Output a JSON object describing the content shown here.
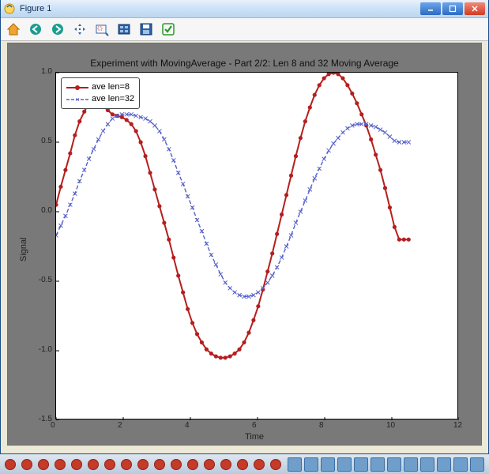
{
  "window": {
    "title": "Figure 1",
    "buttons": {
      "minimize": "_",
      "maximize": "❐",
      "close": "✕"
    }
  },
  "toolbar": {
    "icons": [
      "home",
      "back",
      "forward",
      "pan",
      "zoom",
      "configure",
      "save",
      "check"
    ]
  },
  "chart_data": {
    "type": "line",
    "title": "Experiment with MovingAverage - Part 2/2: Len 8 and 32 Moving Average",
    "xlabel": "Time",
    "ylabel": "Signal",
    "xlim": [
      0,
      12
    ],
    "ylim": [
      -1.5,
      1.0
    ],
    "xticks": [
      0,
      2,
      4,
      6,
      8,
      10,
      12
    ],
    "yticks": [
      -1.5,
      -1.0,
      -0.5,
      0.0,
      0.5,
      1.0
    ],
    "legend": {
      "position": "upper left",
      "entries": [
        "ave len=8",
        "ave len=32"
      ]
    },
    "series": [
      {
        "name": "ave len=8",
        "color": "#b51f1f",
        "marker": "o",
        "linestyle": "solid",
        "x": [
          0.0,
          0.14,
          0.28,
          0.42,
          0.56,
          0.7,
          0.84,
          0.98,
          1.12,
          1.26,
          1.4,
          1.54,
          1.68,
          1.82,
          1.96,
          2.1,
          2.24,
          2.38,
          2.52,
          2.66,
          2.8,
          2.94,
          3.08,
          3.22,
          3.36,
          3.5,
          3.64,
          3.78,
          3.92,
          4.06,
          4.2,
          4.34,
          4.48,
          4.62,
          4.76,
          4.9,
          5.04,
          5.18,
          5.32,
          5.46,
          5.6,
          5.74,
          5.88,
          6.02,
          6.16,
          6.3,
          6.44,
          6.58,
          6.72,
          6.86,
          7.0,
          7.14,
          7.28,
          7.42,
          7.56,
          7.7,
          7.84,
          7.98,
          8.12,
          8.26,
          8.4,
          8.54,
          8.68,
          8.82,
          8.96,
          9.1,
          9.24,
          9.38,
          9.52,
          9.66,
          9.8,
          9.94,
          10.08,
          10.22,
          10.36,
          10.5
        ],
        "y": [
          0.05,
          0.18,
          0.3,
          0.42,
          0.55,
          0.65,
          0.72,
          0.78,
          0.79,
          0.78,
          0.76,
          0.73,
          0.7,
          0.69,
          0.68,
          0.66,
          0.63,
          0.58,
          0.5,
          0.4,
          0.28,
          0.16,
          0.04,
          -0.08,
          -0.2,
          -0.33,
          -0.46,
          -0.58,
          -0.7,
          -0.8,
          -0.88,
          -0.94,
          -0.99,
          -1.02,
          -1.04,
          -1.05,
          -1.05,
          -1.04,
          -1.02,
          -0.99,
          -0.94,
          -0.87,
          -0.78,
          -0.68,
          -0.56,
          -0.43,
          -0.3,
          -0.16,
          -0.02,
          0.12,
          0.26,
          0.4,
          0.53,
          0.65,
          0.75,
          0.84,
          0.91,
          0.96,
          0.99,
          1.0,
          0.99,
          0.96,
          0.91,
          0.85,
          0.78,
          0.7,
          0.62,
          0.52,
          0.41,
          0.3,
          0.17,
          0.03,
          -0.11,
          -0.2,
          -0.2,
          -0.2
        ]
      },
      {
        "name": "ave len=32",
        "color": "#5560c9",
        "marker": "x",
        "linestyle": "dashed",
        "x": [
          0.0,
          0.14,
          0.28,
          0.42,
          0.56,
          0.7,
          0.84,
          0.98,
          1.12,
          1.26,
          1.4,
          1.54,
          1.68,
          1.82,
          1.96,
          2.1,
          2.24,
          2.38,
          2.52,
          2.66,
          2.8,
          2.94,
          3.08,
          3.22,
          3.36,
          3.5,
          3.64,
          3.78,
          3.92,
          4.06,
          4.2,
          4.34,
          4.48,
          4.62,
          4.76,
          4.9,
          5.04,
          5.18,
          5.32,
          5.46,
          5.6,
          5.74,
          5.88,
          6.02,
          6.16,
          6.3,
          6.44,
          6.58,
          6.72,
          6.86,
          7.0,
          7.14,
          7.28,
          7.42,
          7.56,
          7.7,
          7.84,
          7.98,
          8.12,
          8.26,
          8.4,
          8.54,
          8.68,
          8.82,
          8.96,
          9.1,
          9.24,
          9.38,
          9.52,
          9.66,
          9.8,
          9.94,
          10.08,
          10.22,
          10.36,
          10.5
        ],
        "y": [
          -0.17,
          -0.1,
          -0.03,
          0.05,
          0.13,
          0.22,
          0.3,
          0.38,
          0.45,
          0.52,
          0.58,
          0.63,
          0.67,
          0.69,
          0.7,
          0.7,
          0.7,
          0.69,
          0.68,
          0.67,
          0.65,
          0.62,
          0.58,
          0.52,
          0.45,
          0.37,
          0.28,
          0.2,
          0.11,
          0.03,
          -0.06,
          -0.14,
          -0.23,
          -0.31,
          -0.38,
          -0.45,
          -0.51,
          -0.55,
          -0.58,
          -0.6,
          -0.61,
          -0.61,
          -0.6,
          -0.58,
          -0.55,
          -0.51,
          -0.46,
          -0.4,
          -0.33,
          -0.25,
          -0.17,
          -0.08,
          0.0,
          0.08,
          0.16,
          0.24,
          0.31,
          0.38,
          0.44,
          0.49,
          0.53,
          0.57,
          0.6,
          0.62,
          0.63,
          0.63,
          0.63,
          0.62,
          0.61,
          0.59,
          0.57,
          0.54,
          0.51,
          0.5,
          0.5,
          0.5
        ]
      }
    ]
  }
}
